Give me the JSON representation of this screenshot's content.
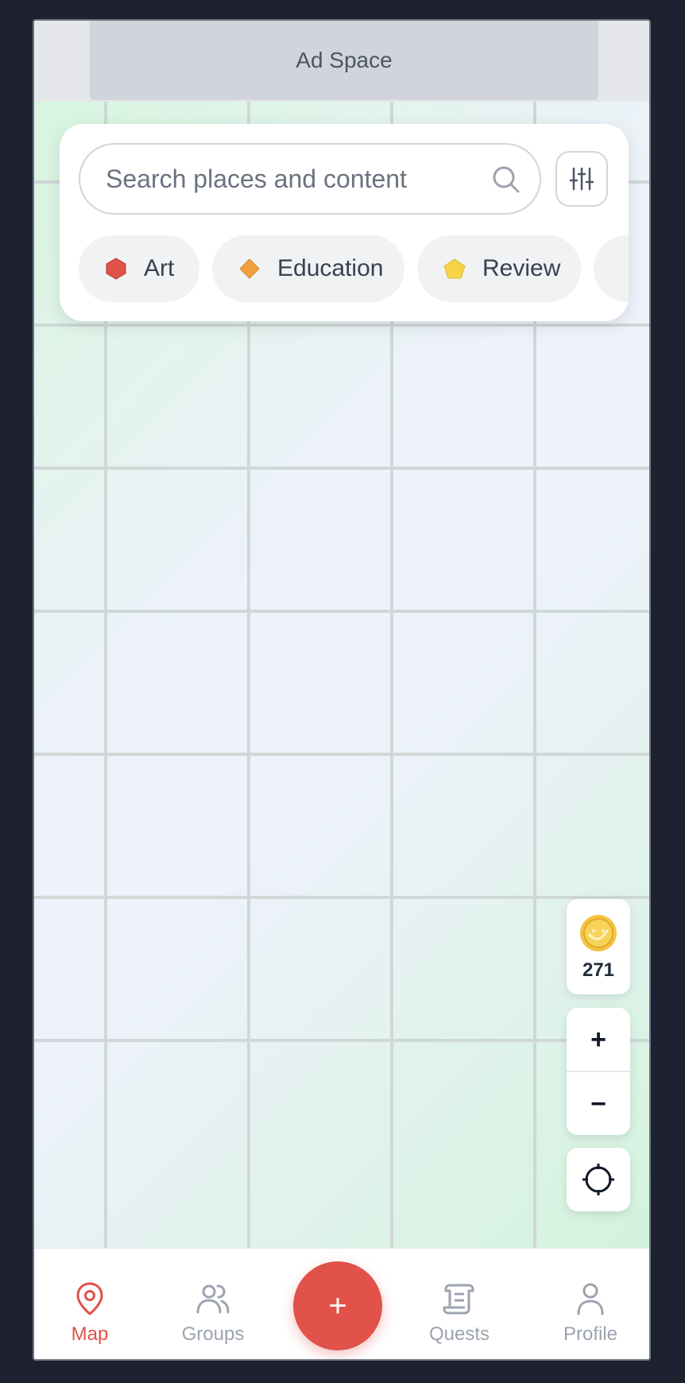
{
  "ad": {
    "label": "Ad Space"
  },
  "search": {
    "placeholder": "Search places and content"
  },
  "filters": {
    "chips": [
      {
        "label": "Art",
        "icon": "hexagon-icon",
        "color": "#e0524a"
      },
      {
        "label": "Education",
        "icon": "diamond-icon",
        "color": "#f2a03d"
      },
      {
        "label": "Review",
        "icon": "pentagon-icon",
        "color": "#f5d547"
      }
    ]
  },
  "coins": {
    "count": "271",
    "icon": "coin-icon"
  },
  "zoom": {
    "in_label": "+",
    "out_label": "−"
  },
  "fab": {
    "label": "+"
  },
  "nav": {
    "items": [
      {
        "label": "Map",
        "icon": "map-pin-icon",
        "active": true
      },
      {
        "label": "Groups",
        "icon": "users-icon",
        "active": false
      },
      {
        "label": "Quests",
        "icon": "scroll-icon",
        "active": false
      },
      {
        "label": "Profile",
        "icon": "user-icon",
        "active": false
      }
    ]
  },
  "colors": {
    "accent": "#e0524a",
    "inactive": "#9ca3af",
    "background": "#1e2230"
  }
}
